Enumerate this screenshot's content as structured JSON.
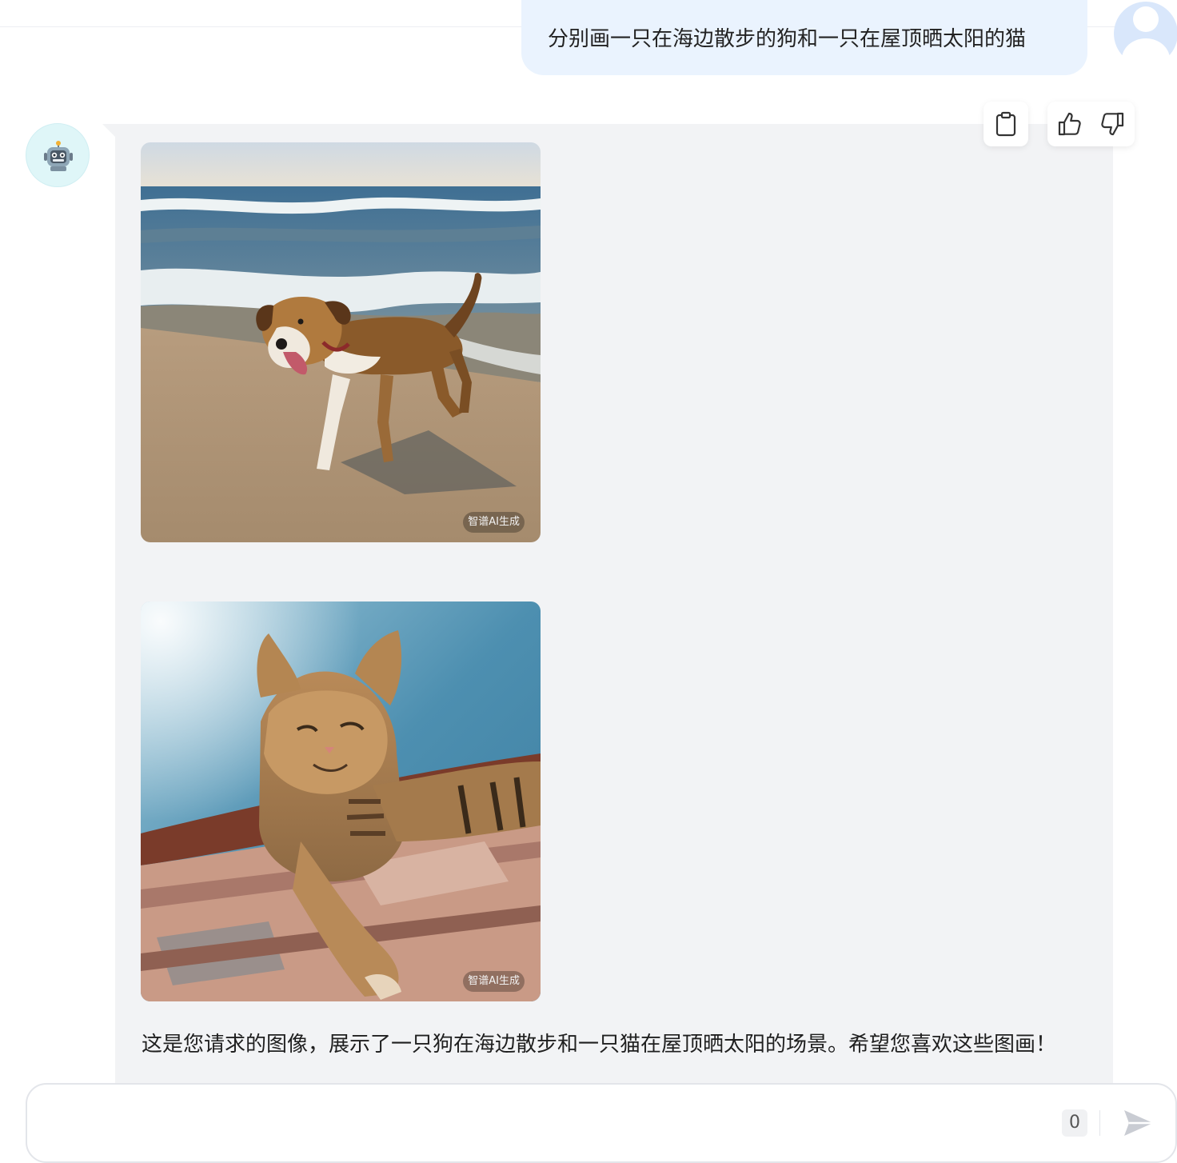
{
  "conversation": {
    "user_message": "分别画一只在海边散步的狗和一只在屋顶晒太阳的猫",
    "assistant": {
      "images": [
        {
          "subject": "dog-walking-on-beach",
          "watermark": "智谱AI生成"
        },
        {
          "subject": "cat-sunbathing-on-roof",
          "watermark": "智谱AI生成"
        }
      ],
      "reply_text": "这是您请求的图像，展示了一只狗在海边散步和一只猫在屋顶晒太阳的场景。希望您喜欢这些图画！"
    }
  },
  "actions": {
    "icons": [
      "clipboard-icon",
      "thumbs-up-icon",
      "thumbs-down-icon"
    ]
  },
  "composer": {
    "value": "",
    "char_count": "0",
    "send_icon": "send-icon"
  },
  "colors": {
    "user_bubble": "#eaf3fe",
    "assistant_bubble": "#f2f3f5",
    "bot_avatar_bg": "#dff6f8"
  }
}
